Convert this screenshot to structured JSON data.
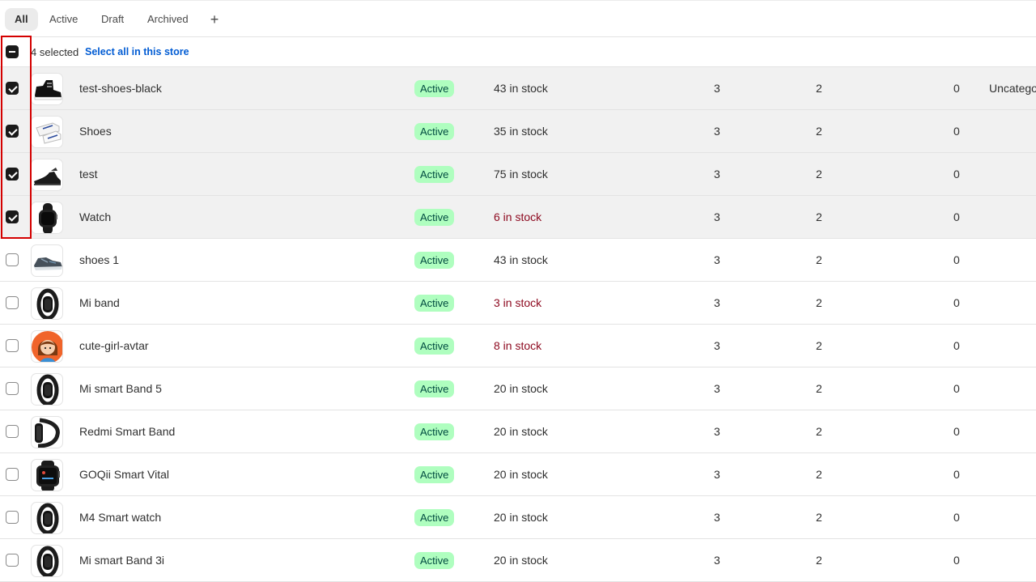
{
  "tabs": [
    {
      "label": "All",
      "active": true
    },
    {
      "label": "Active"
    },
    {
      "label": "Draft"
    },
    {
      "label": "Archived"
    }
  ],
  "add_tab": "+",
  "bulk": {
    "count": "4 selected",
    "select_all": "Select all in this store"
  },
  "status_color": "#affebf",
  "low_stock_color": "#8e0b21",
  "products": [
    {
      "name": "test-shoes-black",
      "status": "Active",
      "stock": "43 in stock",
      "c1": "3",
      "c2": "2",
      "c3": "0",
      "category": "Uncatego",
      "selected": true,
      "image": "black-sneaker"
    },
    {
      "name": "Shoes",
      "status": "Active",
      "stock": "35 in stock",
      "c1": "3",
      "c2": "2",
      "c3": "0",
      "category": "",
      "selected": true,
      "image": "white-shoes"
    },
    {
      "name": "test",
      "status": "Active",
      "stock": "75 in stock",
      "c1": "3",
      "c2": "2",
      "c3": "0",
      "category": "",
      "selected": true,
      "image": "black-formal-shoe"
    },
    {
      "name": "Watch",
      "status": "Active",
      "stock": "6 in stock",
      "low": true,
      "c1": "3",
      "c2": "2",
      "c3": "0",
      "category": "",
      "selected": true,
      "image": "smartwatch"
    },
    {
      "name": "shoes 1",
      "status": "Active",
      "stock": "43 in stock",
      "c1": "3",
      "c2": "2",
      "c3": "0",
      "category": "",
      "selected": false,
      "image": "grey-sneaker"
    },
    {
      "name": "Mi band",
      "status": "Active",
      "stock": "3 in stock",
      "low": true,
      "c1": "3",
      "c2": "2",
      "c3": "0",
      "category": "",
      "selected": false,
      "image": "fitness-band"
    },
    {
      "name": "cute-girl-avtar",
      "status": "Active",
      "stock": "8 in stock",
      "low": true,
      "c1": "3",
      "c2": "2",
      "c3": "0",
      "category": "",
      "selected": false,
      "image": "girl-avatar"
    },
    {
      "name": "Mi smart Band 5",
      "status": "Active",
      "stock": "20 in stock",
      "c1": "3",
      "c2": "2",
      "c3": "0",
      "category": "",
      "selected": false,
      "image": "fitness-band"
    },
    {
      "name": "Redmi Smart Band",
      "status": "Active",
      "stock": "20 in stock",
      "c1": "3",
      "c2": "2",
      "c3": "0",
      "category": "",
      "selected": false,
      "image": "fitness-band-side"
    },
    {
      "name": "GOQii Smart Vital",
      "status": "Active",
      "stock": "20 in stock",
      "c1": "3",
      "c2": "2",
      "c3": "0",
      "category": "",
      "selected": false,
      "image": "square-smartwatch"
    },
    {
      "name": "M4 Smart watch",
      "status": "Active",
      "stock": "20 in stock",
      "c1": "3",
      "c2": "2",
      "c3": "0",
      "category": "",
      "selected": false,
      "image": "fitness-band"
    },
    {
      "name": "Mi smart Band 3i",
      "status": "Active",
      "stock": "20 in stock",
      "c1": "3",
      "c2": "2",
      "c3": "0",
      "category": "",
      "selected": false,
      "image": "fitness-band"
    }
  ]
}
